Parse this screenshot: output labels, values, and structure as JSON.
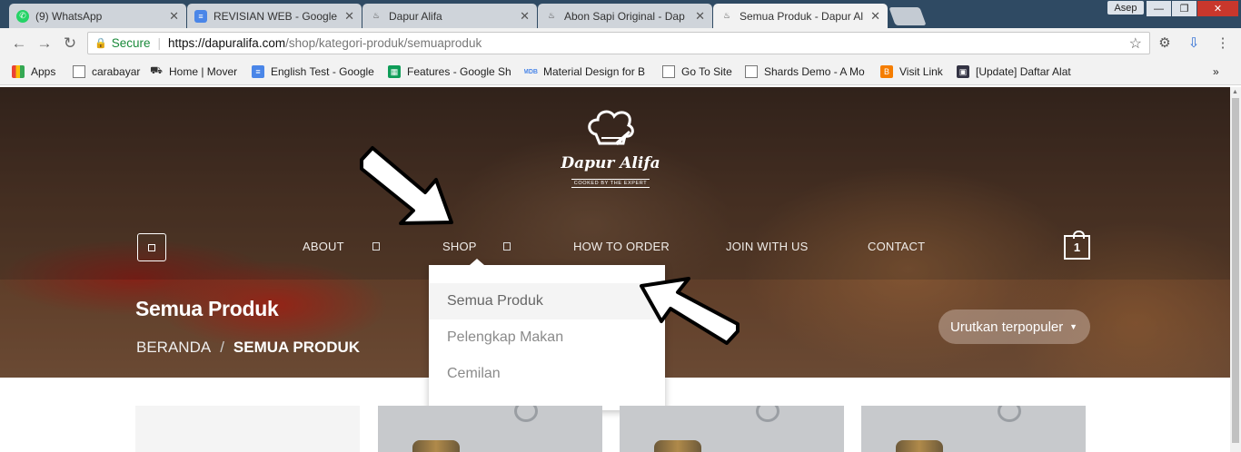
{
  "browser": {
    "tabs": [
      {
        "label": "(9) WhatsApp",
        "icon": "whatsapp-icon",
        "color": "#25d366",
        "active": false
      },
      {
        "label": "REVISIAN WEB - Google D",
        "icon": "google-docs-icon",
        "color": "#4a86e8",
        "active": false
      },
      {
        "label": "Dapur Alifa",
        "icon": "chef-hat-icon",
        "color": "#555555",
        "active": false
      },
      {
        "label": "Abon Sapi Original - Dap",
        "icon": "chef-hat-icon",
        "color": "#555555",
        "active": false
      },
      {
        "label": "Semua Produk - Dapur Al",
        "icon": "chef-hat-icon",
        "color": "#555555",
        "active": true
      }
    ],
    "profile_name": "Asep",
    "address": {
      "secure_label": "Secure",
      "url_host": "https://dapuralifa.com",
      "url_path": "/shop/kategori-produk/semuaproduk"
    },
    "bookmarks": [
      {
        "label": "Apps",
        "icon": "apps-grid-icon"
      },
      {
        "label": "carabayar",
        "icon": "page-icon"
      },
      {
        "label": "Home | Mover",
        "icon": "truck-icon"
      },
      {
        "label": "English Test - Google",
        "icon": "google-docs-icon"
      },
      {
        "label": "Features - Google Sh",
        "icon": "google-sheets-icon"
      },
      {
        "label": "Material Design for B",
        "icon": "mdb-icon"
      },
      {
        "label": "Go To Site",
        "icon": "page-icon"
      },
      {
        "label": "Shards Demo - A Mo",
        "icon": "page-icon"
      },
      {
        "label": "Visit Link",
        "icon": "blogger-icon"
      },
      {
        "label": "[Update] Daftar Alat",
        "icon": "bookmark-image-icon"
      }
    ],
    "more_bookmarks": "»"
  },
  "site": {
    "logo": {
      "brand": "Dapur Alifa",
      "tagline": "COOKED BY THE EXPERT"
    },
    "nav": [
      {
        "label": "ABOUT"
      },
      {
        "label": "SHOP"
      },
      {
        "label": "HOW TO ORDER"
      },
      {
        "label": "JOIN WITH US"
      },
      {
        "label": "CONTACT"
      }
    ],
    "cart_count": "1",
    "page_title": "Semua Produk",
    "breadcrumb": {
      "home": "BERANDA",
      "separator": "/",
      "current": "SEMUA PRODUK"
    },
    "sort_label": "Urutkan terpopuler",
    "dropdown": [
      {
        "label": "Semua Produk",
        "active": true
      },
      {
        "label": "Pelengkap Makan",
        "active": false
      },
      {
        "label": "Cemilan",
        "active": false
      }
    ]
  },
  "colors": {
    "browser_frame": "#2f4a63",
    "secure_green": "#1a8a3a",
    "hero_overlay": "#3c2a22"
  }
}
